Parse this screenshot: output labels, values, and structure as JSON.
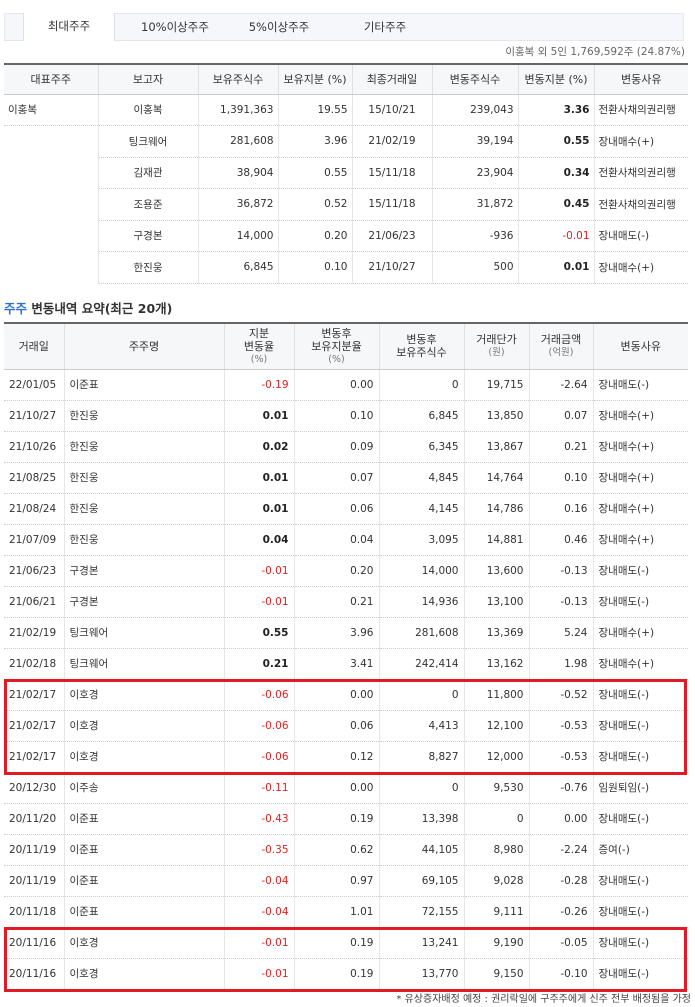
{
  "tabs": [
    "최대주주",
    "10%이상주주",
    "5%이상주주",
    "기타주주"
  ],
  "summary": "이홍복 외 5인 1,769,592주 (24.87%)",
  "major_table": {
    "headers": [
      "대표주주",
      "보고자",
      "보유주식수",
      "보유지분 (%)",
      "최종거래일",
      "변동주식수",
      "변동지분 (%)",
      "변동사유"
    ],
    "representative": "이홍복",
    "rows": [
      {
        "reporter": "이홍복",
        "shares": "1,391,363",
        "stake": "19.55",
        "last_date": "15/10/21",
        "chg_shares": "239,043",
        "chg_stake": "3.36",
        "reason": "전환사채의권리행"
      },
      {
        "reporter": "팅크웨어",
        "shares": "281,608",
        "stake": "3.96",
        "last_date": "21/02/19",
        "chg_shares": "39,194",
        "chg_stake": "0.55",
        "reason": "장내매수(+)"
      },
      {
        "reporter": "김재관",
        "shares": "38,904",
        "stake": "0.55",
        "last_date": "15/11/18",
        "chg_shares": "23,904",
        "chg_stake": "0.34",
        "reason": "전환사채의권리행"
      },
      {
        "reporter": "조용준",
        "shares": "36,872",
        "stake": "0.52",
        "last_date": "15/11/18",
        "chg_shares": "31,872",
        "chg_stake": "0.45",
        "reason": "전환사채의권리행"
      },
      {
        "reporter": "구경본",
        "shares": "14,000",
        "stake": "0.20",
        "last_date": "21/06/23",
        "chg_shares": "-936",
        "chg_stake": "-0.01",
        "reason": "장내매도(-)"
      },
      {
        "reporter": "한진웅",
        "shares": "6,845",
        "stake": "0.10",
        "last_date": "21/10/27",
        "chg_shares": "500",
        "chg_stake": "0.01",
        "reason": "장내매수(+)"
      }
    ]
  },
  "history_section": {
    "title_blue": "주주",
    "title_rest": " 변동내역 요약(최근 20개)"
  },
  "history_table": {
    "headers": [
      {
        "l1": "거래일",
        "l2": ""
      },
      {
        "l1": "주주명",
        "l2": ""
      },
      {
        "l1": "지분",
        "l2": "변동율",
        "l3": "(%)"
      },
      {
        "l1": "변동후",
        "l2": "보유지분율",
        "l3": "(%)"
      },
      {
        "l1": "변동후",
        "l2": "보유주식수",
        "l3": ""
      },
      {
        "l1": "거래단가",
        "l2": "",
        "l3": "(원)"
      },
      {
        "l1": "거래금액",
        "l2": "",
        "l3": "(억원)"
      },
      {
        "l1": "변동사유",
        "l2": ""
      }
    ],
    "rows": [
      {
        "date": "22/01/05",
        "name": "이준표",
        "chg": "-0.19",
        "after": "0.00",
        "shares": "0",
        "price": "19,715",
        "amount": "-2.64",
        "reason": "장내매도(-)"
      },
      {
        "date": "21/10/27",
        "name": "한진웅",
        "chg": "0.01",
        "after": "0.10",
        "shares": "6,845",
        "price": "13,850",
        "amount": "0.07",
        "reason": "장내매수(+)"
      },
      {
        "date": "21/10/26",
        "name": "한진웅",
        "chg": "0.02",
        "after": "0.09",
        "shares": "6,345",
        "price": "13,867",
        "amount": "0.21",
        "reason": "장내매수(+)"
      },
      {
        "date": "21/08/25",
        "name": "한진웅",
        "chg": "0.01",
        "after": "0.07",
        "shares": "4,845",
        "price": "14,764",
        "amount": "0.10",
        "reason": "장내매수(+)"
      },
      {
        "date": "21/08/24",
        "name": "한진웅",
        "chg": "0.01",
        "after": "0.06",
        "shares": "4,145",
        "price": "14,786",
        "amount": "0.16",
        "reason": "장내매수(+)"
      },
      {
        "date": "21/07/09",
        "name": "한진웅",
        "chg": "0.04",
        "after": "0.04",
        "shares": "3,095",
        "price": "14,881",
        "amount": "0.46",
        "reason": "장내매수(+)"
      },
      {
        "date": "21/06/23",
        "name": "구경본",
        "chg": "-0.01",
        "after": "0.20",
        "shares": "14,000",
        "price": "13,600",
        "amount": "-0.13",
        "reason": "장내매도(-)"
      },
      {
        "date": "21/06/21",
        "name": "구경본",
        "chg": "-0.01",
        "after": "0.21",
        "shares": "14,936",
        "price": "13,100",
        "amount": "-0.13",
        "reason": "장내매도(-)"
      },
      {
        "date": "21/02/19",
        "name": "팅크웨어",
        "chg": "0.55",
        "after": "3.96",
        "shares": "281,608",
        "price": "13,369",
        "amount": "5.24",
        "reason": "장내매수(+)"
      },
      {
        "date": "21/02/18",
        "name": "팅크웨어",
        "chg": "0.21",
        "after": "3.41",
        "shares": "242,414",
        "price": "13,162",
        "amount": "1.98",
        "reason": "장내매수(+)"
      },
      {
        "date": "21/02/17",
        "name": "이호경",
        "chg": "-0.06",
        "after": "0.00",
        "shares": "0",
        "price": "11,800",
        "amount": "-0.52",
        "reason": "장내매도(-)"
      },
      {
        "date": "21/02/17",
        "name": "이호경",
        "chg": "-0.06",
        "after": "0.06",
        "shares": "4,413",
        "price": "12,100",
        "amount": "-0.53",
        "reason": "장내매도(-)"
      },
      {
        "date": "21/02/17",
        "name": "이호경",
        "chg": "-0.06",
        "after": "0.12",
        "shares": "8,827",
        "price": "12,000",
        "amount": "-0.53",
        "reason": "장내매도(-)"
      },
      {
        "date": "20/12/30",
        "name": "이주송",
        "chg": "-0.11",
        "after": "0.00",
        "shares": "0",
        "price": "9,530",
        "amount": "-0.76",
        "reason": "임원퇴임(-)"
      },
      {
        "date": "20/11/20",
        "name": "이준표",
        "chg": "-0.43",
        "after": "0.19",
        "shares": "13,398",
        "price": "0",
        "amount": "0.00",
        "reason": "장내매도(-)"
      },
      {
        "date": "20/11/19",
        "name": "이준표",
        "chg": "-0.35",
        "after": "0.62",
        "shares": "44,105",
        "price": "8,980",
        "amount": "-2.24",
        "reason": "증여(-)"
      },
      {
        "date": "20/11/19",
        "name": "이준표",
        "chg": "-0.04",
        "after": "0.97",
        "shares": "69,105",
        "price": "9,028",
        "amount": "-0.28",
        "reason": "장내매도(-)"
      },
      {
        "date": "20/11/18",
        "name": "이준표",
        "chg": "-0.04",
        "after": "1.01",
        "shares": "72,155",
        "price": "9,111",
        "amount": "-0.26",
        "reason": "장내매도(-)"
      },
      {
        "date": "20/11/16",
        "name": "이호경",
        "chg": "-0.01",
        "after": "0.19",
        "shares": "13,241",
        "price": "9,190",
        "amount": "-0.05",
        "reason": "장내매도(-)"
      },
      {
        "date": "20/11/16",
        "name": "이호경",
        "chg": "-0.01",
        "after": "0.19",
        "shares": "13,770",
        "price": "9,150",
        "amount": "-0.10",
        "reason": "장내매도(-)"
      }
    ]
  },
  "footnote": "* 유상증자배정 예정 : 권리락일에 구주주에게 신주 전부 배정됨을 가정",
  "colors": {
    "negative": "#e02020",
    "highlight": "#e01b24",
    "accent": "#2f6fd1"
  }
}
